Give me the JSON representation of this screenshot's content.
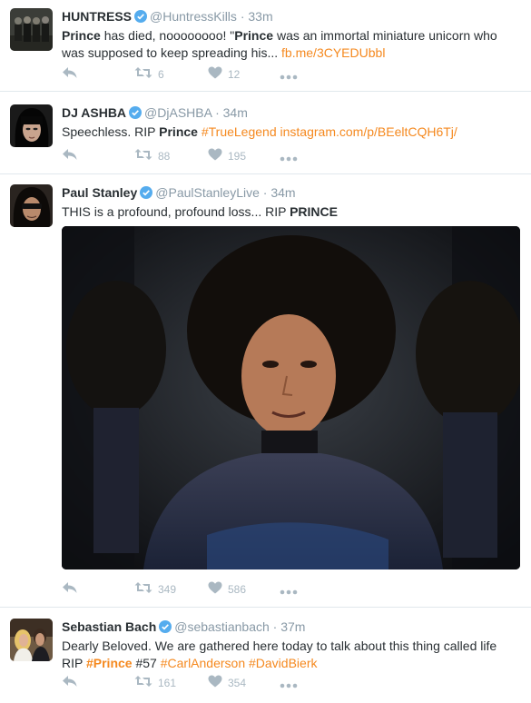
{
  "tweets": [
    {
      "name": "HUNTRESS",
      "handle": "@HuntressKills",
      "sep": "·",
      "time": "33m",
      "segments": [
        {
          "t": "Prince",
          "s": "b"
        },
        {
          "t": " has died, noooooooo! \"",
          "s": "n"
        },
        {
          "t": "Prince",
          "s": "b"
        },
        {
          "t": " was an immortal miniature unicorn who was supposed to keep spreading his... ",
          "s": "n"
        },
        {
          "t": "fb.me/3CYEDUbbl",
          "s": "l"
        }
      ],
      "retweets": "6",
      "likes": "12"
    },
    {
      "name": "DJ ASHBA",
      "handle": "@DjASHBA",
      "sep": "·",
      "time": "34m",
      "segments": [
        {
          "t": "Speechless. RIP ",
          "s": "n"
        },
        {
          "t": "Prince",
          "s": "b"
        },
        {
          "t": " ",
          "s": "n"
        },
        {
          "t": "#TrueLegend",
          "s": "l"
        },
        {
          "t": " ",
          "s": "n"
        },
        {
          "t": "instagram.com/p/BEeltCQH6Tj/",
          "s": "l"
        }
      ],
      "retweets": "88",
      "likes": "195"
    },
    {
      "name": "Paul Stanley",
      "handle": "@PaulStanleyLive",
      "sep": "·",
      "time": "34m",
      "segments": [
        {
          "t": "THIS is a profound, profound loss... RIP ",
          "s": "n"
        },
        {
          "t": "PRINCE",
          "s": "b"
        }
      ],
      "retweets": "349",
      "likes": "586"
    },
    {
      "name": "Sebastian Bach",
      "handle": "@sebastianbach",
      "sep": "·",
      "time": "37m",
      "segments": [
        {
          "t": "Dearly Beloved. We are gathered here today to talk about this thing called life RIP ",
          "s": "n"
        },
        {
          "t": "#Prince",
          "s": "lb"
        },
        {
          "t": " #57 ",
          "s": "n"
        },
        {
          "t": "#CarlAnderson",
          "s": "l"
        },
        {
          "t": " ",
          "s": "n"
        },
        {
          "t": "#DavidBierk",
          "s": "l"
        }
      ],
      "retweets": "161",
      "likes": "354"
    }
  ],
  "icons": {
    "reply": "reply-icon",
    "retweet": "retweet-icon",
    "like": "heart-icon",
    "more": "more-icon",
    "verified": "verified-badge-icon"
  },
  "colors": {
    "link": "#f5891f",
    "action": "#aab8c2",
    "verified": "#55acee",
    "meta": "#8899a6"
  }
}
